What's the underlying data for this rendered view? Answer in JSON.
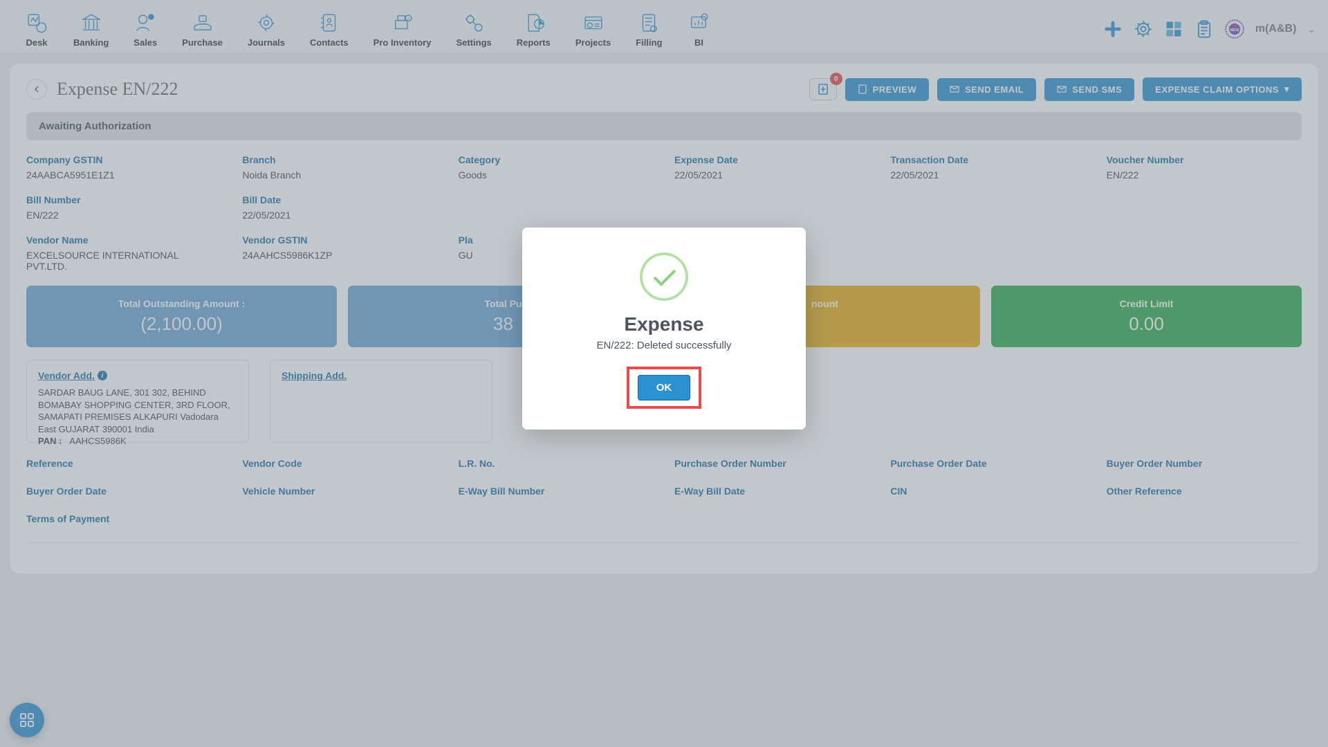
{
  "nav": {
    "items": [
      {
        "label": "Desk"
      },
      {
        "label": "Banking"
      },
      {
        "label": "Sales"
      },
      {
        "label": "Purchase"
      },
      {
        "label": "Journals"
      },
      {
        "label": "Contacts"
      },
      {
        "label": "Pro Inventory"
      },
      {
        "label": "Settings"
      },
      {
        "label": "Reports"
      },
      {
        "label": "Projects"
      },
      {
        "label": "Filling"
      },
      {
        "label": "BI"
      }
    ],
    "user": "m(A&B)"
  },
  "page": {
    "title": "Expense EN/222",
    "attach_badge": "0",
    "buttons": {
      "preview": "PREVIEW",
      "email": "SEND EMAIL",
      "sms": "SEND SMS",
      "claim": "EXPENSE CLAIM OPTIONS"
    },
    "status": "Awaiting Authorization"
  },
  "fields": {
    "company_gstin": {
      "label": "Company GSTIN",
      "value": "24AABCA5951E1Z1"
    },
    "branch": {
      "label": "Branch",
      "value": "Noida Branch"
    },
    "category": {
      "label": "Category",
      "value": "Goods"
    },
    "expense_date": {
      "label": "Expense Date",
      "value": "22/05/2021"
    },
    "transaction_date": {
      "label": "Transaction Date",
      "value": "22/05/2021"
    },
    "voucher_number": {
      "label": "Voucher Number",
      "value": "EN/222"
    },
    "bill_number": {
      "label": "Bill Number",
      "value": "EN/222"
    },
    "bill_date": {
      "label": "Bill Date",
      "value": "22/05/2021"
    },
    "vendor_name": {
      "label": "Vendor Name",
      "value": "EXCELSOURCE INTERNATIONAL PVT.LTD."
    },
    "vendor_gstin": {
      "label": "Vendor GSTIN",
      "value": "24AAHCS5986K1ZP"
    },
    "place_supply": {
      "label": "Pla",
      "value": "GU"
    }
  },
  "summary": {
    "outstanding": {
      "label": "Total Outstanding Amount :",
      "value": "(2,100.00)"
    },
    "purchase": {
      "label": "Total Pu",
      "value": "38"
    },
    "amount": {
      "label": "nount",
      "value": ""
    },
    "credit": {
      "label": "Credit Limit",
      "value": "0.00"
    }
  },
  "addresses": {
    "vendor": {
      "title": "Vendor Add.",
      "body": "SARDAR BAUG LANE, 301 302, BEHIND BOMABAY SHOPPING CENTER, 3RD FLOOR, SAMAPATI PREMISES ALKAPURI Vadodara East GUJARAT 390001 India",
      "pan_label": "PAN :",
      "pan_value": "AAHCS5986K"
    },
    "shipping": {
      "title": "Shipping Add."
    }
  },
  "refs": {
    "reference": "Reference",
    "vendor_code": "Vendor Code",
    "lr_no": "L.R. No.",
    "po_number": "Purchase Order Number",
    "po_date": "Purchase Order Date",
    "buyer_order_number": "Buyer Order Number",
    "buyer_order_date": "Buyer Order Date",
    "vehicle_number": "Vehicle Number",
    "eway_number": "E-Way Bill Number",
    "eway_date": "E-Way Bill Date",
    "cin": "CIN",
    "other_reference": "Other Reference",
    "terms": "Terms of Payment"
  },
  "modal": {
    "title": "Expense",
    "message": "EN/222: Deleted successfully",
    "ok": "OK"
  }
}
